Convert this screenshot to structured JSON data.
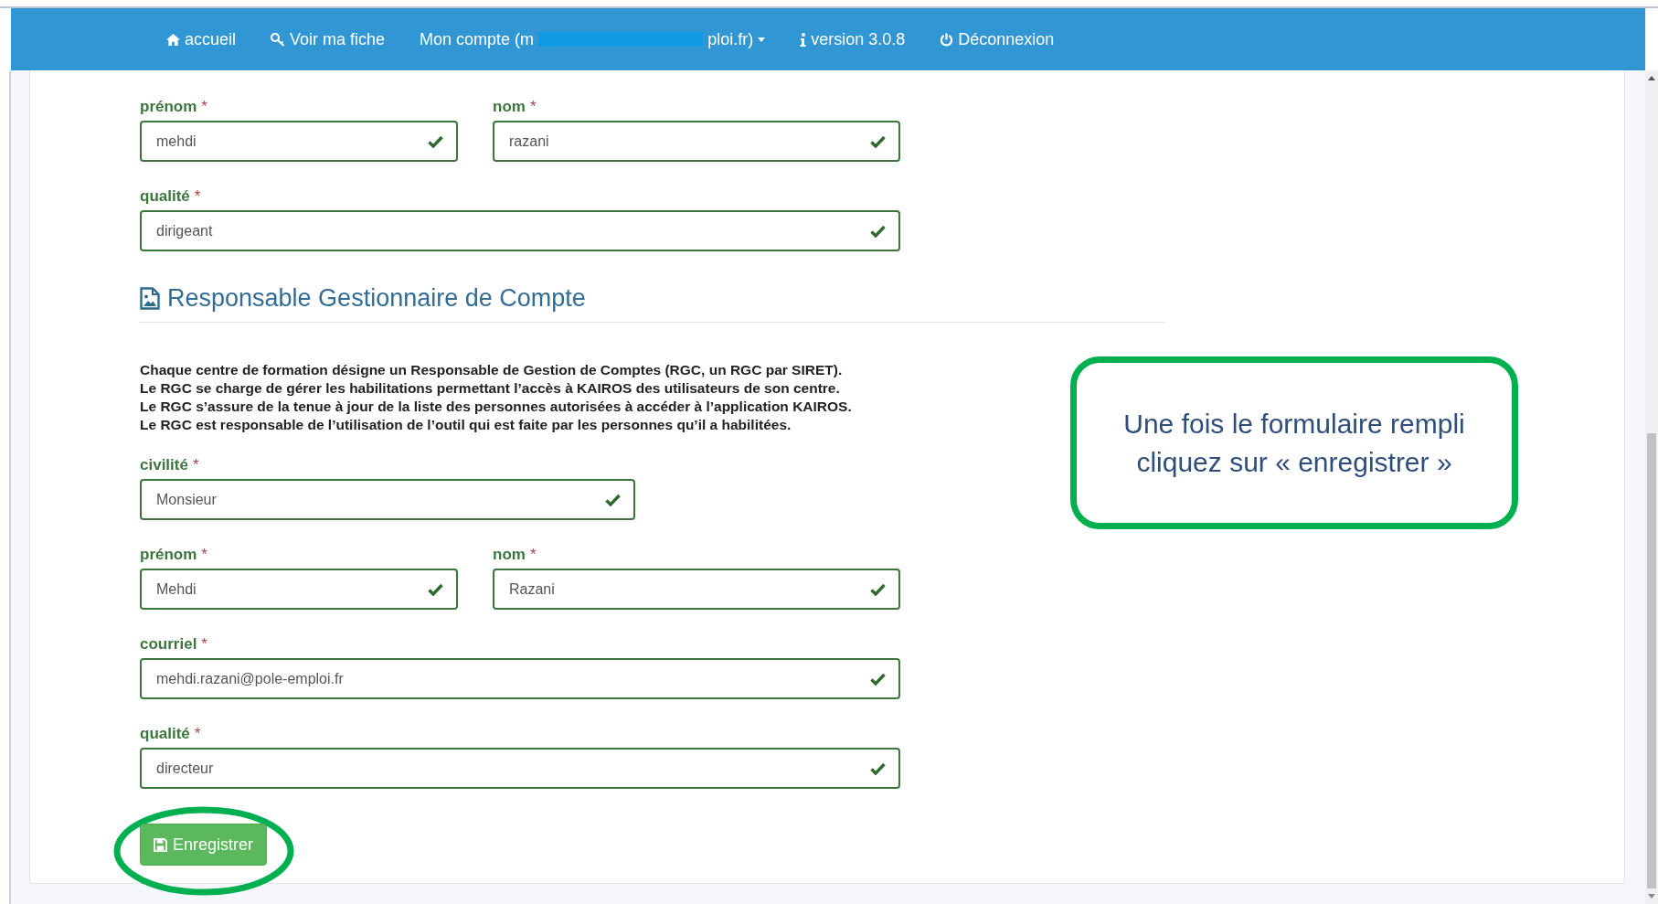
{
  "navbar": {
    "items": [
      {
        "label": "accueil",
        "dropdown": false
      },
      {
        "label": "Voir ma fiche",
        "dropdown": false
      },
      {
        "label": "Mon compte (m",
        "label_end": "ploi.fr)",
        "redacted": true,
        "dropdown": true
      },
      {
        "label": "version 3.0.8",
        "dropdown": false
      },
      {
        "label": "Déconnexion",
        "dropdown": false
      }
    ]
  },
  "top_fields": [
    [
      {
        "kind": "text",
        "label": "prénom",
        "required_mark": "*",
        "value": "mehdi",
        "valid": true
      },
      {
        "kind": "text",
        "label": "nom",
        "required_mark": "*",
        "value": "razani",
        "valid": true
      }
    ],
    [
      {
        "kind": "text",
        "label": "qualité",
        "required_mark": "*",
        "value": "dirigeant",
        "valid": true
      }
    ]
  ],
  "section": {
    "title": "Responsable Gestionnaire de Compte",
    "paragraph": [
      "Chaque centre de formation désigne un Responsable de Gestion de Comptes (RGC, un RGC par SIRET).",
      "Le RGC se charge de gérer les habilitations permettant l’accès à KAIROS des utilisateurs de son centre.",
      "Le RGC s’assure de la tenue à jour de la liste des personnes autorisées à accéder à l’application KAIROS.",
      "Le RGC est responsable de l’utilisation de l’outil qui est faite par les personnes qu’il a habilitées."
    ],
    "fields": [
      [
        {
          "kind": "select",
          "label": "civilité",
          "required_mark": "*",
          "value": "Monsieur",
          "valid": true
        }
      ],
      [
        {
          "kind": "text",
          "label": "prénom",
          "required_mark": "*",
          "value": "Mehdi",
          "valid": true
        },
        {
          "kind": "text",
          "label": "nom",
          "required_mark": "*",
          "value": "Razani",
          "valid": true
        }
      ],
      [
        {
          "kind": "text",
          "label": "courriel",
          "required_mark": "*",
          "value": "mehdi.razani@pole-emploi.fr",
          "valid": true
        }
      ],
      [
        {
          "kind": "text",
          "label": "qualité",
          "required_mark": "*",
          "value": "directeur",
          "valid": true
        }
      ]
    ]
  },
  "save_button": {
    "label": "Enregistrer",
    "highlighted": true
  },
  "callout": {
    "lines": [
      "Une fois le formulaire rempli",
      "cliquez sur « enregistrer »"
    ]
  }
}
